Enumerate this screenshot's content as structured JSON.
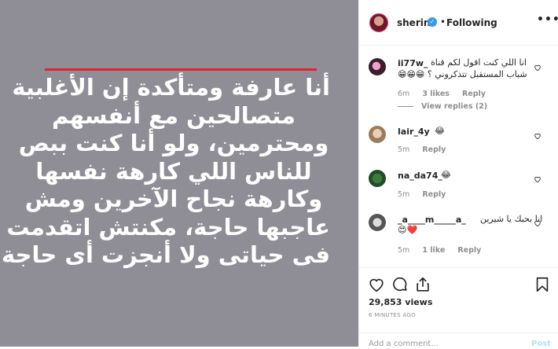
{
  "media": {
    "arabic_lines": [
      "أنا عارفة ومتأكدة إن الأغلبية",
      "متصالحين مع أنفسهم",
      "ومحترمين، ولو أنا كنت ببص",
      "للناس اللي كارهة نفسها",
      "وكارهة نجاح الآخرين ومش",
      "عاجبها حاجة، مكنتش اتقدمت",
      "فى حياتى ولا أنجزت أى حاجة"
    ]
  },
  "header": {
    "username": "sherine",
    "verified_glyph": "✓",
    "separator": "•",
    "follow_label": "Following",
    "more_label": "•••"
  },
  "comments": [
    {
      "username": "ii77w_",
      "text_line1": "انا اللي كنت اقول لكم قناة",
      "text_line2": "شباب المستقبل تتذكروني ؟ 😁😁😁",
      "time": "6m",
      "likes": "3 likes",
      "reply": "Reply",
      "view_replies": "View replies (2)"
    },
    {
      "username": "lair_4y",
      "text": "😂",
      "time": "5m",
      "reply": "Reply"
    },
    {
      "username": "na_da74_",
      "text": "😂",
      "time": "5m",
      "reply": "Reply"
    },
    {
      "username": "_a____m_____a_",
      "text_line1": "انا بحبك يا شيرين",
      "text_line2": "😍❤️",
      "time": "5m",
      "likes": "1 like",
      "reply": "Reply"
    }
  ],
  "stats": {
    "views": "29,853 views",
    "posted": "6 MINUTES AGO"
  },
  "composer": {
    "placeholder": "Add a comment...",
    "post_label": "Post"
  },
  "colors": {
    "media_bg": "#8f8e97",
    "accent_red": "#e8222b",
    "verified_blue": "#3897f0",
    "post_disabled": "#b2dffc"
  },
  "icons": [
    "heart-icon",
    "comment-icon",
    "share-icon",
    "bookmark-icon",
    "verified-icon",
    "more-icon"
  ]
}
